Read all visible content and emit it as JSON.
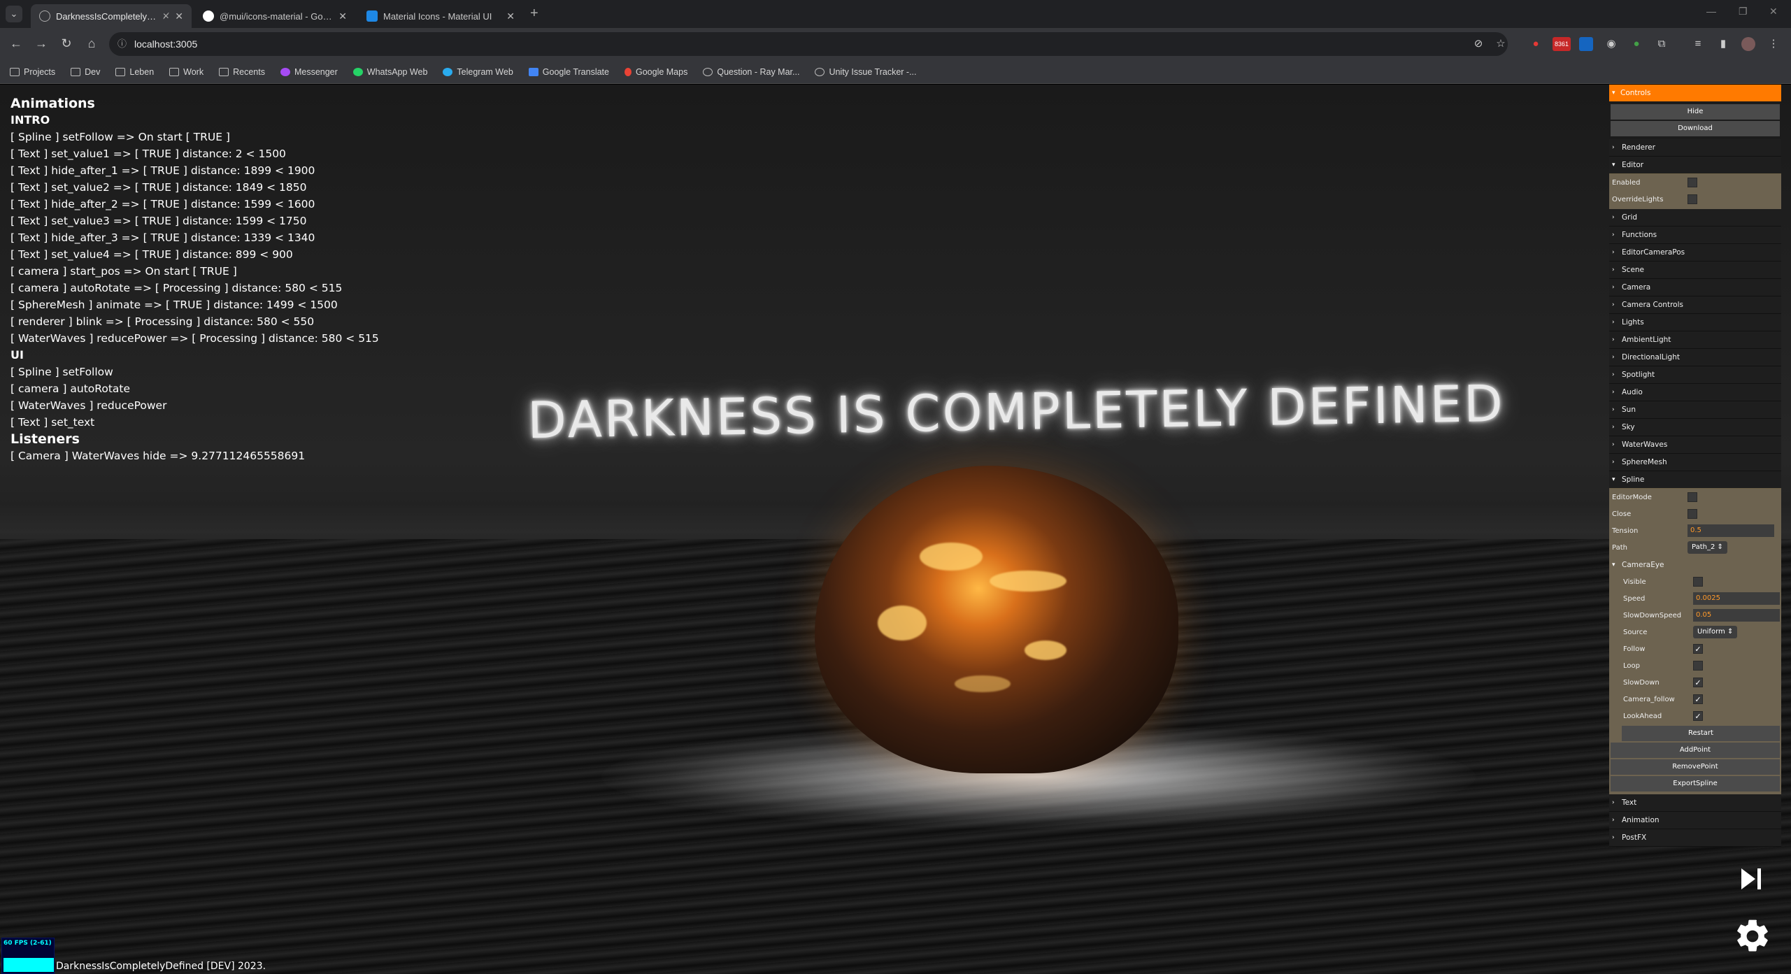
{
  "browser": {
    "tabs": [
      {
        "title": "DarknessIsCompletelyDefin",
        "active": true
      },
      {
        "title": "@mui/icons-material - Google",
        "active": false
      },
      {
        "title": "Material Icons - Material UI",
        "active": false
      }
    ],
    "url": "localhost:3005",
    "bookmarks": [
      "Projects",
      "Dev",
      "Leben",
      "Work",
      "Recents",
      "Messenger",
      "WhatsApp Web",
      "Telegram Web",
      "Google Translate",
      "Google Maps",
      "Question - Ray Mar...",
      "Unity Issue Tracker -..."
    ],
    "extension_badge": "8361"
  },
  "scene": {
    "headline": "DARKNESS IS COMPLETELY DEFINED"
  },
  "debug": {
    "title": "Animations",
    "intro_heading": "INTRO",
    "intro_lines": [
      "[ Spline ] setFollow => On start [ TRUE ]",
      "[ Text ] set_value1 => [ TRUE ] distance: 2 < 1500",
      "[ Text ] hide_after_1 => [ TRUE ] distance: 1899 < 1900",
      "[ Text ] set_value2 => [ TRUE ] distance: 1849 < 1850",
      "[ Text ] hide_after_2 => [ TRUE ] distance: 1599 < 1600",
      "[ Text ] set_value3 => [ TRUE ] distance: 1599 < 1750",
      "[ Text ] hide_after_3 => [ TRUE ] distance: 1339 < 1340",
      "[ Text ] set_value4 => [ TRUE ] distance: 899 < 900",
      "[ camera ] start_pos => On start [ TRUE ]",
      "[ camera ] autoRotate => [ Processing ] distance: 580 < 515",
      "[ SphereMesh ] animate => [ TRUE ] distance: 1499 < 1500",
      "[ renderer ] blink => [ Processing ] distance: 580 < 550",
      "[ WaterWaves ] reducePower => [ Processing ] distance: 580 < 515"
    ],
    "ui_heading": "UI",
    "ui_lines": [
      "[ Spline ] setFollow",
      "[ camera ] autoRotate",
      "[ WaterWaves ] reducePower",
      "[ Text ] set_text"
    ],
    "listeners_heading": "Listeners",
    "listener_lines": [
      "[ Camera ] WaterWaves hide => 9.277112465558691"
    ]
  },
  "panel": {
    "header": "Controls",
    "hide_label": "Hide",
    "download_label": "Download",
    "renderer": "Renderer",
    "editor": "Editor",
    "editor_enabled": "Enabled",
    "editor_override": "OverrideLights",
    "groups_a": [
      "Grid",
      "Functions",
      "EditorCameraPos",
      "Scene",
      "Camera",
      "Camera Controls",
      "Lights",
      "AmbientLight",
      "DirectionalLight",
      "Spotlight",
      "Audio",
      "Sun",
      "Sky",
      "WaterWaves",
      "SphereMesh"
    ],
    "spline": "Spline",
    "spline_editormode": "EditorMode",
    "spline_close": "Close",
    "spline_tension": "Tension",
    "spline_tension_value": "0.5",
    "spline_path": "Path",
    "spline_path_value": "Path_2",
    "camera_eye": "CameraEye",
    "ce_visible": "Visible",
    "ce_speed": "Speed",
    "ce_speed_value": "0.0025",
    "ce_slowdownspeed": "SlowDownSpeed",
    "ce_slowdownspeed_value": "0.05",
    "ce_source": "Source",
    "ce_source_value": "Uniform",
    "ce_follow": "Follow",
    "ce_loop": "Loop",
    "ce_slowdown": "SlowDown",
    "ce_camera_follow": "Camera_follow",
    "ce_lookahead": "LookAhead",
    "restart_label": "Restart",
    "addpoint_label": "AddPoint",
    "removepoint_label": "RemovePoint",
    "exportspline_label": "ExportSpline",
    "groups_b": [
      "Text",
      "Animation",
      "PostFX"
    ]
  },
  "stats": {
    "fps_text": "60 FPS (2-61)"
  },
  "footer": "DarknessIsCompletelyDefined [DEV] 2023.",
  "colors": {
    "accent": "#ff7a00",
    "panel_open_bg": "#6d6350",
    "fps_cyan": "#00ffff"
  },
  "icons": [
    "back-icon",
    "forward-icon",
    "reload-icon",
    "home-icon",
    "star-icon",
    "play-next-icon",
    "settings-gear-icon"
  ]
}
